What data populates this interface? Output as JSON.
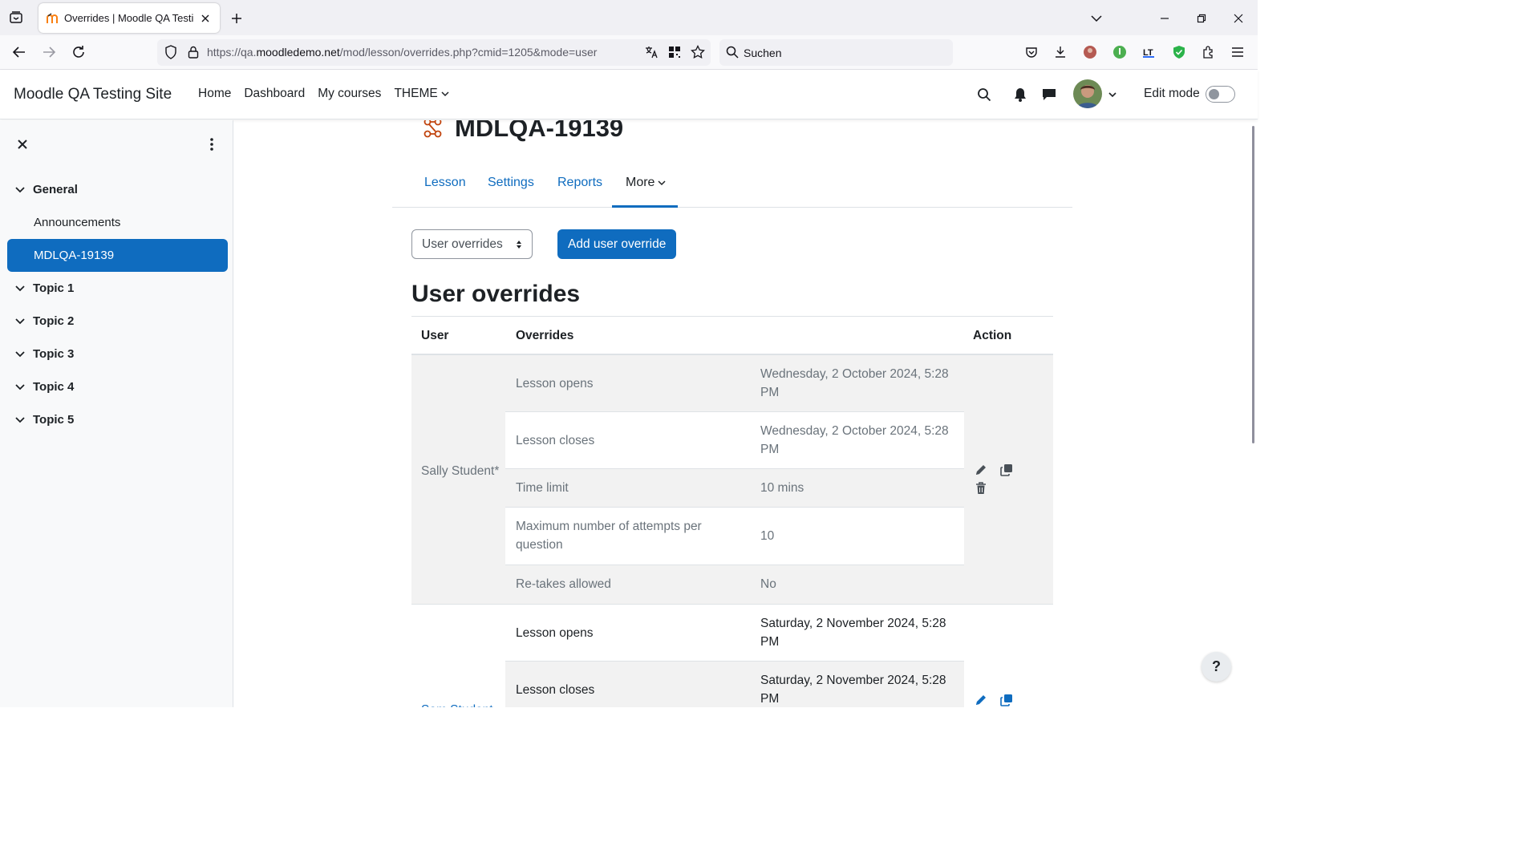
{
  "browser": {
    "tab_title": "Overrides | Moodle QA Testing",
    "url_prefix": "https://qa.",
    "url_host": "moodledemo.net",
    "url_path": "/mod/lesson/overrides.php?cmid=1205&mode=user",
    "search_placeholder": "Suchen"
  },
  "header": {
    "site_name": "Moodle QA Testing Site",
    "nav": [
      "Home",
      "Dashboard",
      "My courses",
      "THEME"
    ],
    "edit_mode_label": "Edit mode",
    "edit_mode_on": false
  },
  "course_index": {
    "sections": [
      {
        "title": "General",
        "items": [
          "Announcements",
          "MDLQA-19139"
        ]
      },
      {
        "title": "Topic 1"
      },
      {
        "title": "Topic 2"
      },
      {
        "title": "Topic 3"
      },
      {
        "title": "Topic 4"
      },
      {
        "title": "Topic 5"
      }
    ],
    "active_item": "MDLQA-19139"
  },
  "page": {
    "title": "MDLQA-19139",
    "tabs": [
      "Lesson",
      "Settings",
      "Reports",
      "More"
    ],
    "active_tab": "More",
    "select_value": "User overrides",
    "add_button": "Add user override",
    "section_title": "User overrides"
  },
  "table": {
    "headers": {
      "user": "User",
      "overrides": "Overrides",
      "action": "Action"
    },
    "users": [
      {
        "name": "Sally Student*",
        "rows": [
          {
            "label": "Lesson opens",
            "value": "Wednesday, 2 October 2024, 5:28 PM"
          },
          {
            "label": "Lesson closes",
            "value": "Wednesday, 2 October 2024, 5:28 PM"
          },
          {
            "label": "Time limit",
            "value": "10 mins"
          },
          {
            "label": "Maximum number of attempts per question",
            "value": "10"
          },
          {
            "label": "Re-takes allowed",
            "value": "No"
          }
        ]
      },
      {
        "name": "Sam Student",
        "rows": [
          {
            "label": "Lesson opens",
            "value": "Saturday, 2 November 2024, 5:28 PM"
          },
          {
            "label": "Lesson closes",
            "value": "Saturday, 2 November 2024, 5:28 PM"
          }
        ]
      }
    ]
  },
  "help_label": "?",
  "colors": {
    "primary": "#0f6cbf",
    "text": "#1d2125",
    "muted": "#6a737b"
  }
}
